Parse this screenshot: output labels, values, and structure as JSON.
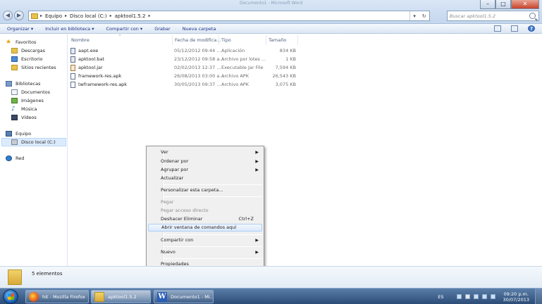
{
  "window": {
    "title": "Documento1 - Microsoft Word",
    "search_placeholder": "Buscar apktool1.5.2",
    "breadcrumbs": [
      "Equipo",
      "Disco local (C:)",
      "apktool1.5.2"
    ]
  },
  "toolbar": {
    "organize": "Organizar ▾",
    "include_library": "Incluir en biblioteca ▾",
    "share": "Compartir con ▾",
    "burn": "Grabar",
    "new_folder": "Nueva carpeta"
  },
  "nav": {
    "favorites": "Favoritos",
    "downloads": "Descargas",
    "desktop": "Escritorio",
    "recent": "Sitios recientes",
    "libraries": "Bibliotecas",
    "documents": "Documentos",
    "images": "Imágenes",
    "music": "Música",
    "videos": "Vídeos",
    "computer": "Equipo",
    "local_disk": "Disco local (C:)",
    "network": "Red"
  },
  "columns": {
    "name": "Nombre",
    "date": "Fecha de modifica...",
    "type": "Tipo",
    "size": "Tamaño"
  },
  "files": [
    {
      "name": "aapt.exe",
      "date": "05/12/2012 09:44 ...",
      "type": "Aplicación",
      "size": "834 KB",
      "kind": "exe"
    },
    {
      "name": "apktool.bat",
      "date": "23/12/2012 09:58 a...",
      "type": "Archivo por lotes ...",
      "size": "1 KB",
      "kind": "bat"
    },
    {
      "name": "apktool.jar",
      "date": "02/02/2013 12:37 ...",
      "type": "Executable Jar File",
      "size": "7,594 KB",
      "kind": "jar"
    },
    {
      "name": "framework-res.apk",
      "date": "26/08/2013 03:00 a...",
      "type": "Archivo APK",
      "size": "26,543 KB",
      "kind": "apk"
    },
    {
      "name": "twframework-res.apk",
      "date": "30/05/2013 09:37 ...",
      "type": "Archivo APK",
      "size": "3,075 KB",
      "kind": "apk"
    }
  ],
  "context_menu": {
    "view": "Ver",
    "sort": "Ordenar por",
    "group": "Agrupar por",
    "refresh": "Actualizar",
    "customize": "Personalizar esta carpeta...",
    "paste": "Pegar",
    "paste_shortcut": "Pegar acceso directo",
    "undo": "Deshacer Eliminar",
    "undo_shortcut": "Ctrl+Z",
    "open_cmd": "Abrir ventana de comandos aquí",
    "share": "Compartir con",
    "new": "Nuevo",
    "properties": "Propiedades"
  },
  "details": {
    "count": "5 elementos"
  },
  "taskbar": {
    "firefox": "hit - Mozilla Firefox",
    "folder": "apktool1.5.2",
    "word": "Documento1 - Mi...",
    "lang": "ES",
    "time": "09:20 p.m.",
    "date": "30/07/2013"
  }
}
